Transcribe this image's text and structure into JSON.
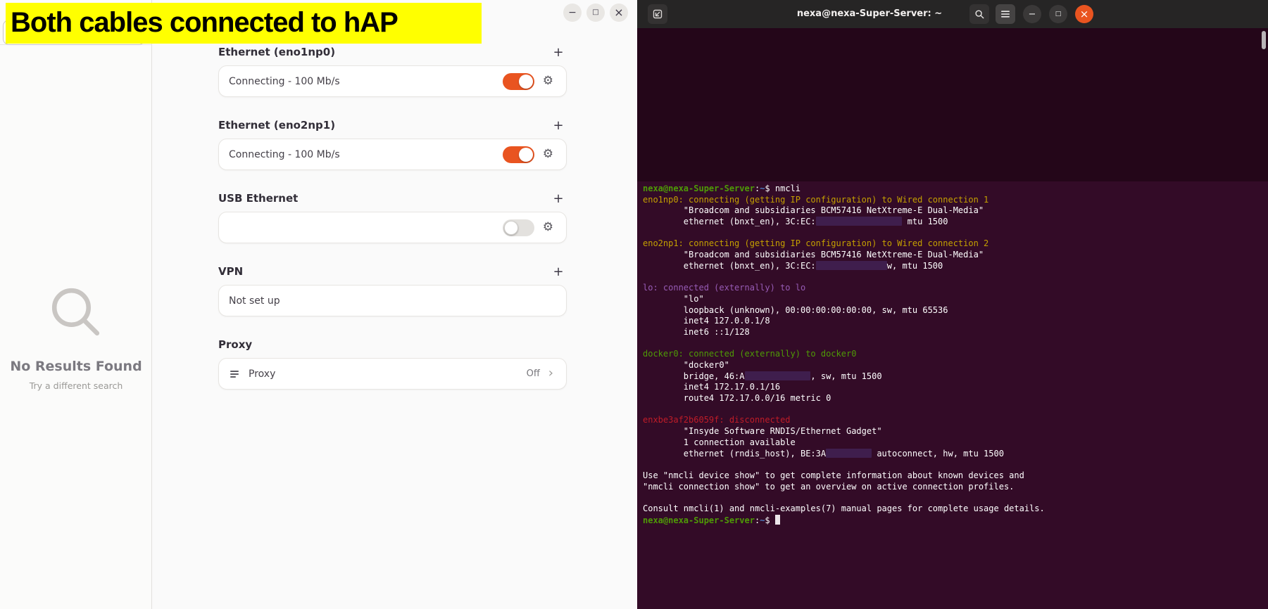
{
  "annotation": {
    "text": "Both cables connected to hAP",
    "bg_color": "#ffff00"
  },
  "settings": {
    "accent_color": "#E95420",
    "window_controls": {
      "minimize": "−",
      "maximize": "□",
      "close": "×"
    },
    "sidebar": {
      "no_results_title": "No Results Found",
      "no_results_hint": "Try a different search"
    },
    "sections": [
      {
        "title": "Ethernet (eno1np0)",
        "add_label": "+",
        "card": {
          "label": "Connecting - 100 Mb/s",
          "toggle": "on"
        }
      },
      {
        "title": "Ethernet (eno2np1)",
        "add_label": "+",
        "card": {
          "label": "Connecting - 100 Mb/s",
          "toggle": "on"
        }
      },
      {
        "title": "USB Ethernet",
        "add_label": "+",
        "card": {
          "label": "",
          "toggle": "off"
        }
      },
      {
        "title": "VPN",
        "add_label": "+",
        "card": {
          "label": "Not set up"
        }
      },
      {
        "title": "Proxy",
        "card": {
          "label": "Proxy",
          "status": "Off",
          "chevron": "›"
        }
      }
    ]
  },
  "terminal": {
    "title": "nexa@nexa-Super-Server: ~",
    "window_controls": {
      "minimize": "−",
      "maximize": "□",
      "close": "×"
    },
    "colors": {
      "bg": "#330B27",
      "green": "#4E9A06",
      "yellow": "#C4A000",
      "purple": "#975BB5",
      "red": "#C01C28",
      "blue": "#4E7CBF",
      "white": "#FFFFFF"
    },
    "lines": [
      [
        {
          "t": "nexa@nexa-Super-Server",
          "c": "green",
          "b": true
        },
        {
          "t": ":",
          "c": "white"
        },
        {
          "t": "~",
          "c": "blue",
          "b": true
        },
        {
          "t": "$ nmcli",
          "c": "white"
        }
      ],
      [
        {
          "t": "eno1np0: connecting (getting IP configuration) to Wired connection 1",
          "c": "yellow"
        }
      ],
      [
        {
          "t": "        \"Broadcom and subsidiaries BCM57416 NetXtreme-E Dual-Media\"",
          "c": "white"
        }
      ],
      [
        {
          "t": "        ethernet (bnxt_en), 3C:EC:",
          "c": "white"
        },
        {
          "redact": true,
          "ch": 17
        },
        {
          "t": " mtu 1500",
          "c": "white"
        }
      ],
      [],
      [
        {
          "t": "eno2np1: connecting (getting IP configuration) to Wired connection 2",
          "c": "yellow"
        }
      ],
      [
        {
          "t": "        \"Broadcom and subsidiaries BCM57416 NetXtreme-E Dual-Media\"",
          "c": "white"
        }
      ],
      [
        {
          "t": "        ethernet (bnxt_en), 3C:EC:",
          "c": "white"
        },
        {
          "redact": true,
          "ch": 14
        },
        {
          "t": "w, mtu 1500",
          "c": "white"
        }
      ],
      [],
      [
        {
          "t": "lo: connected (externally) to lo",
          "c": "purple"
        }
      ],
      [
        {
          "t": "        \"lo\"",
          "c": "white"
        }
      ],
      [
        {
          "t": "        loopback (unknown), 00:00:00:00:00:00, sw, mtu 65536",
          "c": "white"
        }
      ],
      [
        {
          "t": "        inet4 127.0.0.1/8",
          "c": "white"
        }
      ],
      [
        {
          "t": "        inet6 ::1/128",
          "c": "white"
        }
      ],
      [],
      [
        {
          "t": "docker0: connected (externally) to docker0",
          "c": "green"
        }
      ],
      [
        {
          "t": "        \"docker0\"",
          "c": "white"
        }
      ],
      [
        {
          "t": "        bridge, 46:A",
          "c": "white"
        },
        {
          "redact": true,
          "ch": 13
        },
        {
          "t": ", sw, mtu 1500",
          "c": "white"
        }
      ],
      [
        {
          "t": "        inet4 172.17.0.1/16",
          "c": "white"
        }
      ],
      [
        {
          "t": "        route4 172.17.0.0/16 metric 0",
          "c": "white"
        }
      ],
      [],
      [
        {
          "t": "enxbe3af2b6059f: disconnected",
          "c": "red"
        }
      ],
      [
        {
          "t": "        \"Insyde Software RNDIS/Ethernet Gadget\"",
          "c": "white"
        }
      ],
      [
        {
          "t": "        1 connection available",
          "c": "white"
        }
      ],
      [
        {
          "t": "        ethernet (rndis_host), BE:3A",
          "c": "white"
        },
        {
          "redact": true,
          "ch": 9
        },
        {
          "t": " autoconnect, hw, mtu 1500",
          "c": "white"
        }
      ],
      [],
      [
        {
          "t": "Use \"nmcli device show\" to get complete information about known devices and",
          "c": "white"
        }
      ],
      [
        {
          "t": "\"nmcli connection show\" to get an overview on active connection profiles.",
          "c": "white"
        }
      ],
      [],
      [
        {
          "t": "Consult nmcli(1) and nmcli-examples(7) manual pages for complete usage details.",
          "c": "white"
        }
      ],
      [
        {
          "t": "nexa@nexa-Super-Server",
          "c": "green",
          "b": true
        },
        {
          "t": ":",
          "c": "white"
        },
        {
          "t": "~",
          "c": "blue",
          "b": true
        },
        {
          "t": "$ ",
          "c": "white"
        },
        {
          "cursor": true
        }
      ]
    ]
  }
}
